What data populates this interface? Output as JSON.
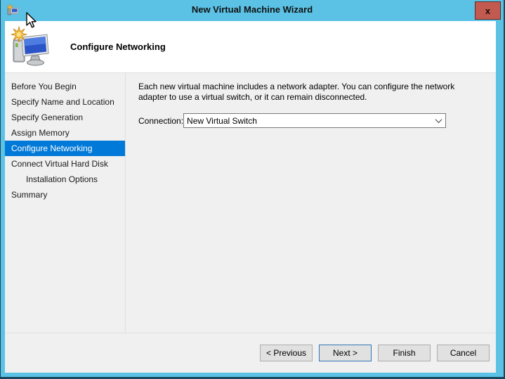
{
  "window": {
    "title": "New Virtual Machine Wizard",
    "close_glyph": "x"
  },
  "header": {
    "title": "Configure Networking"
  },
  "sidebar": {
    "selected_item": "Configure Networking",
    "items": [
      {
        "label": "Before You Begin"
      },
      {
        "label": "Specify Name and Location"
      },
      {
        "label": "Specify Generation"
      },
      {
        "label": "Assign Memory"
      },
      {
        "label": "Configure Networking"
      },
      {
        "label": "Connect Virtual Hard Disk"
      },
      {
        "label": "Installation Options"
      },
      {
        "label": "Summary"
      }
    ]
  },
  "main": {
    "description": "Each new virtual machine includes a network adapter. You can configure the network adapter to use a virtual switch, or it can remain disconnected.",
    "connection": {
      "label": "Connection:",
      "value": "New Virtual Switch"
    }
  },
  "footer": {
    "previous_label": "< Previous",
    "next_label": "Next >",
    "finish_label": "Finish",
    "cancel_label": "Cancel"
  },
  "colors": {
    "titlebar_blue": "#5bc2e6",
    "selection_blue": "#0079d8",
    "close_red": "#c35a50",
    "frame_dark": "#17475f",
    "header_bg": "#ffffff",
    "body_bg": "#f0f0f0"
  }
}
